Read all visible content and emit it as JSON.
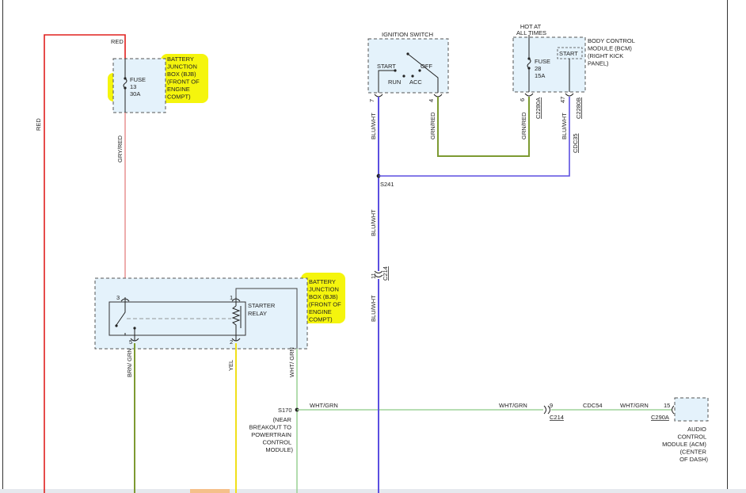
{
  "wires": {
    "red_top": "RED",
    "red_side": "RED",
    "gry_red": "GRY/RED",
    "blu_wht_1": "BLU/WHT",
    "blu_wht_2": "BLU/WHT",
    "blu_wht_3": "BLU/WHT",
    "grn_red_1": "GRN/RED",
    "grn_red_2": "GRN/RED",
    "blu_wht_bcm": "BLU/WHT",
    "brn_grn": "BRN/ GRN",
    "yel": "YEL",
    "wht_grn_v": "WHT/ GRN",
    "wht_grn_1": "WHT/GRN",
    "wht_grn_2": "WHT/GRN",
    "wht_grn_3": "WHT/GRN",
    "cdc54": "CDC54",
    "cdc35": "CDC35"
  },
  "bjb_top": {
    "label_lines": [
      "BATTERY",
      "JUNCTION",
      "BOX (BJB)",
      "(FRONT OF",
      "ENGINE",
      "COMPT)"
    ],
    "fuse_lines": [
      "FUSE",
      "13",
      "30A"
    ]
  },
  "ignition": {
    "title": "IGNITION SWITCH",
    "start": "START",
    "off": "OFF",
    "run": "RUN",
    "acc": "ACC",
    "pin7": "7",
    "pin4": "4"
  },
  "bcm": {
    "hot_lines": [
      "HOT AT",
      "ALL TIMES"
    ],
    "label_lines": [
      "BODY CONTROL",
      "MODULE (BCM)",
      "(RIGHT KICK",
      "PANEL)"
    ],
    "start": "START",
    "fuse_lines": [
      "FUSE",
      "28",
      "15A"
    ],
    "pin6": "6",
    "pin47": "47",
    "conn_a": "C2280A",
    "conn_b": "C2280B"
  },
  "splice_s241": "S241",
  "c214_top": {
    "pin": "11",
    "conn": "C214"
  },
  "bjb_bottom": {
    "label_lines": [
      "BATTERY",
      "JUNCTION",
      "BOX (BJB)",
      "(FRONT OF",
      "ENGINE",
      "COMPT)"
    ],
    "relay_lines": [
      "STARTER",
      "RELAY"
    ],
    "pin3": "3",
    "pin1": "1",
    "pin5": "5",
    "pin2": "2"
  },
  "s170": {
    "name": "S170",
    "desc_lines": [
      "(NEAR",
      "BREAKOUT TO",
      "POWERTRAIN",
      "CONTROL",
      "MODULE)"
    ]
  },
  "c214_bottom": {
    "pin": "9",
    "conn": "C214"
  },
  "acm": {
    "pin": "15",
    "conn": "C290A",
    "label_lines": [
      "AUDIO",
      "CONTROL",
      "MODULE (ACM)",
      "(CENTER",
      "OF DASH)"
    ]
  },
  "colors": {
    "red": "#e0201e",
    "pink": "#e58a8a",
    "blue": "#5b4fe0",
    "olive": "#7d9a32",
    "yellow": "#f0e01a",
    "lightgreen": "#9fd49a",
    "highlight": "#f4f400"
  }
}
